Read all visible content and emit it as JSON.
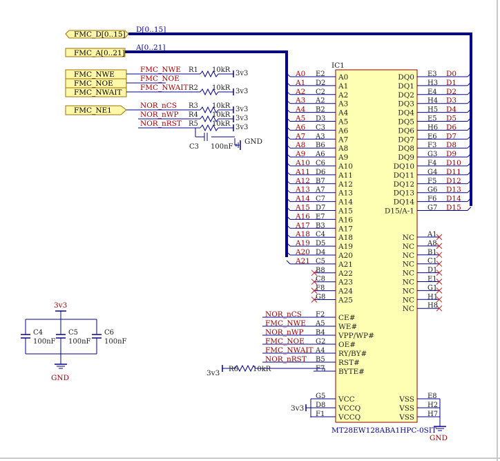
{
  "colors": {
    "wire": "#00008b",
    "bus": "#00008b",
    "label": "#a00000",
    "ic_fill": "#ffffb4",
    "port_fill": "#fff8a8",
    "frame": "#c8c8c8",
    "nc_x": "#cc2020"
  },
  "ports": [
    {
      "id": "fmc_d",
      "text": "FMC_D[0..15]"
    },
    {
      "id": "fmc_a",
      "text": "FMC_A[0..21]"
    },
    {
      "id": "fmc_nwe",
      "text": "FMC_NWE"
    },
    {
      "id": "fmc_noe",
      "text": "FMC_NOE"
    },
    {
      "id": "fmc_nwait",
      "text": "FMC_NWAIT"
    },
    {
      "id": "fmc_ne1",
      "text": "FMC_NE1"
    }
  ],
  "bus_labels": {
    "data": "D[0..15]",
    "addr": "A[0..21]"
  },
  "net_labels": {
    "nwe": "FMC_NWE",
    "noe": "FMC_NOE",
    "nwait": "FMC_NWAIT",
    "ncs": "NOR_nCS",
    "nwp": "NOR_nWP",
    "nrst": "NOR_nRST"
  },
  "resistors": [
    {
      "ref": "R1",
      "value": "10kR",
      "rail": "3v3"
    },
    {
      "ref": "R2",
      "value": "10kR",
      "rail": "3v3"
    },
    {
      "ref": "R3",
      "value": "10kR",
      "rail": "3v3"
    },
    {
      "ref": "R4",
      "value": "10kR",
      "rail": "3v3"
    },
    {
      "ref": "R5",
      "value": "10kR",
      "rail": "3v3"
    },
    {
      "ref": "R6",
      "value": "10kR",
      "rail": "3v3"
    }
  ],
  "c3": {
    "ref": "C3",
    "value": "100nF",
    "gnd": "GND"
  },
  "decoupling": {
    "rail": "3v3",
    "gnd": "GND",
    "caps": [
      {
        "ref": "C4",
        "value": "100nF"
      },
      {
        "ref": "C5",
        "value": "100nF"
      },
      {
        "ref": "C6",
        "value": "100nF"
      }
    ]
  },
  "ic": {
    "ref": "IC1",
    "part": "MT28EW128ABA1HPC-0SIT",
    "left_pins": [
      {
        "net": "A0",
        "ball": "E2",
        "name": "A0"
      },
      {
        "net": "A1",
        "ball": "D2",
        "name": "A1"
      },
      {
        "net": "A2",
        "ball": "C2",
        "name": "A2"
      },
      {
        "net": "A3",
        "ball": "A2",
        "name": "A3"
      },
      {
        "net": "A4",
        "ball": "B2",
        "name": "A4"
      },
      {
        "net": "A5",
        "ball": "D3",
        "name": "A5"
      },
      {
        "net": "A6",
        "ball": "C3",
        "name": "A6"
      },
      {
        "net": "A7",
        "ball": "A3",
        "name": "A7"
      },
      {
        "net": "A8",
        "ball": "B6",
        "name": "A8"
      },
      {
        "net": "A9",
        "ball": "A6",
        "name": "A9"
      },
      {
        "net": "A10",
        "ball": "C6",
        "name": "A10"
      },
      {
        "net": "A11",
        "ball": "D6",
        "name": "A11"
      },
      {
        "net": "A12",
        "ball": "B7",
        "name": "A12"
      },
      {
        "net": "A13",
        "ball": "A7",
        "name": "A13"
      },
      {
        "net": "A14",
        "ball": "C7",
        "name": "A14"
      },
      {
        "net": "A15",
        "ball": "D7",
        "name": "A15"
      },
      {
        "net": "A16",
        "ball": "E7",
        "name": "A16"
      },
      {
        "net": "A17",
        "ball": "B3",
        "name": "A17"
      },
      {
        "net": "A18",
        "ball": "C4",
        "name": "A18"
      },
      {
        "net": "A19",
        "ball": "D5",
        "name": "A19"
      },
      {
        "net": "A20",
        "ball": "D4",
        "name": "A20"
      },
      {
        "net": "A21",
        "ball": "C5",
        "name": "A21"
      },
      {
        "net": "",
        "ball": "B8",
        "name": "A22"
      },
      {
        "net": "",
        "ball": "C8",
        "name": "A23"
      },
      {
        "net": "",
        "ball": "F8",
        "name": "A24"
      },
      {
        "net": "",
        "ball": "G8",
        "name": "A25"
      }
    ],
    "right_pins": [
      {
        "name": "DQ0",
        "ball": "E3",
        "net": "D0"
      },
      {
        "name": "DQ1",
        "ball": "H3",
        "net": "D1"
      },
      {
        "name": "DQ2",
        "ball": "E4",
        "net": "D2"
      },
      {
        "name": "DQ3",
        "ball": "H4",
        "net": "D3"
      },
      {
        "name": "DQ4",
        "ball": "H5",
        "net": "D4"
      },
      {
        "name": "DQ5",
        "ball": "E5",
        "net": "D5"
      },
      {
        "name": "DQ6",
        "ball": "H6",
        "net": "D6"
      },
      {
        "name": "DQ7",
        "ball": "E6",
        "net": "D7"
      },
      {
        "name": "DQ8",
        "ball": "F3",
        "net": "D8"
      },
      {
        "name": "DQ9",
        "ball": "G3",
        "net": "D9"
      },
      {
        "name": "DQ10",
        "ball": "F4",
        "net": "D10"
      },
      {
        "name": "DQ11",
        "ball": "G4",
        "net": "D11"
      },
      {
        "name": "DQ12",
        "ball": "F5",
        "net": "D12"
      },
      {
        "name": "DQ13",
        "ball": "G6",
        "net": "D13"
      },
      {
        "name": "DQ14",
        "ball": "F6",
        "net": "D14"
      },
      {
        "name": "D15/A-1",
        "ball": "G7",
        "net": "D15"
      }
    ],
    "nc_pins": [
      {
        "name": "NC",
        "ball": "A1"
      },
      {
        "name": "NC",
        "ball": "A8"
      },
      {
        "name": "NC",
        "ball": "B1"
      },
      {
        "name": "NC",
        "ball": "C1"
      },
      {
        "name": "NC",
        "ball": "D1"
      },
      {
        "name": "NC",
        "ball": "E1"
      },
      {
        "name": "NC",
        "ball": "G1"
      },
      {
        "name": "NC",
        "ball": "H1"
      },
      {
        "name": "NC",
        "ball": "H8"
      }
    ],
    "ctrl_pins": [
      {
        "net": "NOR_nCS",
        "ball": "F2",
        "name": "CE#"
      },
      {
        "net": "FMC_NWE",
        "ball": "A5",
        "name": "WE#"
      },
      {
        "net": "NOR_nWP",
        "ball": "B4",
        "name": "VPP/WP#"
      },
      {
        "net": "FMC_NOE",
        "ball": "G2",
        "name": "OE#"
      },
      {
        "net": "FMC_NWAIT",
        "ball": "A4",
        "name": "RY/BY#"
      },
      {
        "net": "NOR_nRST",
        "ball": "B5",
        "name": "RST#"
      },
      {
        "net": "",
        "ball": "F7",
        "name": "BYTE#"
      }
    ],
    "power_pins": [
      {
        "ball": "G5",
        "name": "VCC"
      },
      {
        "ball": "D8",
        "name": "VCCQ"
      },
      {
        "ball": "F1",
        "name": "VCCQ"
      }
    ],
    "gnd_pins": [
      {
        "ball": "E8",
        "name": "VSS"
      },
      {
        "ball": "H2",
        "name": "VSS"
      },
      {
        "ball": "H7",
        "name": "VSS"
      }
    ],
    "vcc_label": "3v3",
    "gnd_label": "GND"
  }
}
